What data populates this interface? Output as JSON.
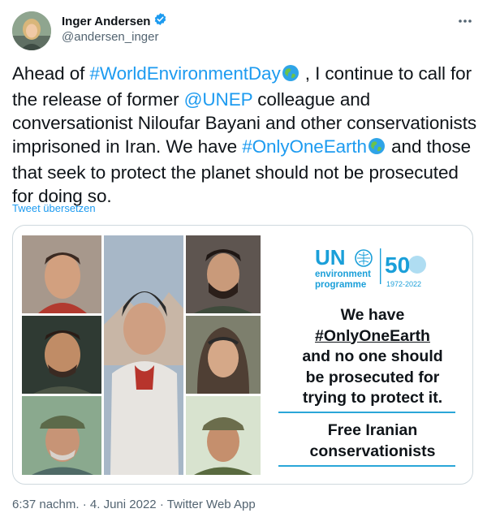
{
  "user": {
    "name": "Inger Andersen",
    "handle": "@andersen_inger",
    "verified": true
  },
  "tweet": {
    "text": {
      "p1": "Ahead of ",
      "hashtag1": "#WorldEnvironmentDay",
      "p2": " , I continue to call for the release of former ",
      "mention": "@UNEP",
      "p3": " colleague and conversationist Niloufar Bayani and other conservationists imprisoned in Iran. We have ",
      "hashtag2": "#OnlyOneEarth",
      "p4": " and those that seek to protect the planet should not be prosecuted for doing so."
    },
    "translate_label": "Tweet übersetzen"
  },
  "card": {
    "logo": {
      "un": "UN",
      "env1": "environment",
      "env2": "programme",
      "fifty": "50",
      "years": "1972-2022"
    },
    "message": {
      "line1": "We have",
      "hashtag": "#OnlyOneEarth",
      "line3": "and no one should",
      "line4": "be prosecuted for",
      "line5": "trying to protect it."
    },
    "cta": {
      "line1": "Free Iranian",
      "line2": "conservationists"
    }
  },
  "meta": {
    "time": "6:37 nachm.",
    "date": "4. Juni 2022",
    "source": "Twitter Web App",
    "separator": "·"
  },
  "colors": {
    "link": "#1d9bf0",
    "un_blue": "#1a9fd9",
    "verified": "#1d9bf0"
  },
  "icons": [
    "verified-badge-icon",
    "more-options-icon",
    "earth-globe-icon"
  ]
}
